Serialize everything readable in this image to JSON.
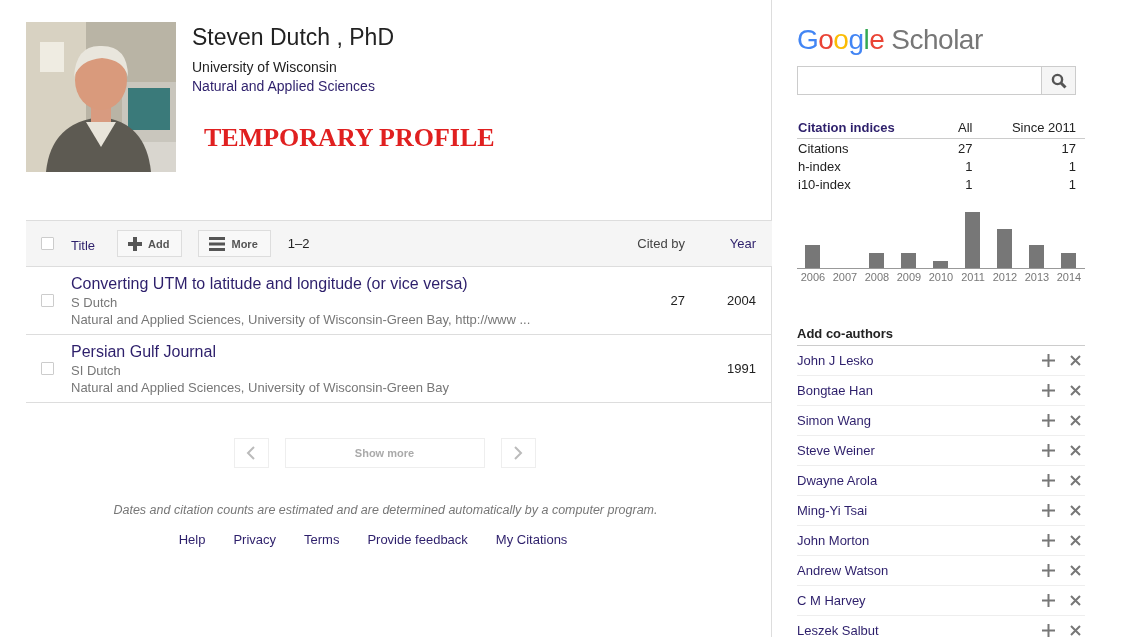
{
  "profile": {
    "name": "Steven Dutch , PhD",
    "affiliation": "University of Wisconsin",
    "interests": "Natural and Applied Sciences",
    "stamp": "TEMPORARY PROFILE"
  },
  "articles_toolbar": {
    "select_all_checked": false,
    "title_sort": "Title",
    "add": "Add",
    "more": "More",
    "range": "1–2",
    "cited_by": "Cited by",
    "year": "Year"
  },
  "articles": [
    {
      "title": "Converting UTM to latitude and longitude (or vice versa)",
      "authors": "S Dutch",
      "venue": "Natural and Applied Sciences, University of Wisconsin-Green Bay, http://www ...",
      "cited_by": "27",
      "year": "2004",
      "checked": false
    },
    {
      "title": "Persian Gulf Journal",
      "authors": "SI Dutch",
      "venue": "Natural and Applied Sciences, University of Wisconsin-Green Bay",
      "year": "1991",
      "checked": false
    }
  ],
  "pagination": {
    "show_more": "Show more",
    "disabled": true
  },
  "footer": {
    "note": "Dates and citation counts are estimated and are determined automatically by a computer program.",
    "links": [
      "Help",
      "Privacy",
      "Terms",
      "Provide feedback",
      "My Citations"
    ]
  },
  "sidebar": {
    "logo": {
      "brand": "Google",
      "product": "Scholar"
    },
    "citation_indices": {
      "columns": [
        "Citation indices",
        "All",
        "Since 2011"
      ],
      "rows": [
        {
          "label": "Citations",
          "all": "27",
          "since": "17"
        },
        {
          "label": "h-index",
          "all": "1",
          "since": "1"
        },
        {
          "label": "i10-index",
          "all": "1",
          "since": "1"
        }
      ]
    },
    "histogram_years": [
      "2006",
      "2007",
      "2008",
      "2009",
      "2010",
      "2011",
      "2012",
      "2013",
      "2014"
    ],
    "coauthors_heading": "Add co-authors",
    "coauthors": [
      "John J Lesko",
      "Bongtae Han",
      "Simon Wang",
      "Steve Weiner",
      "Dwayne Arola",
      "Ming-Yi Tsai",
      "John Morton",
      "Andrew Watson",
      "C M Harvey",
      "Leszek Salbut"
    ]
  }
}
